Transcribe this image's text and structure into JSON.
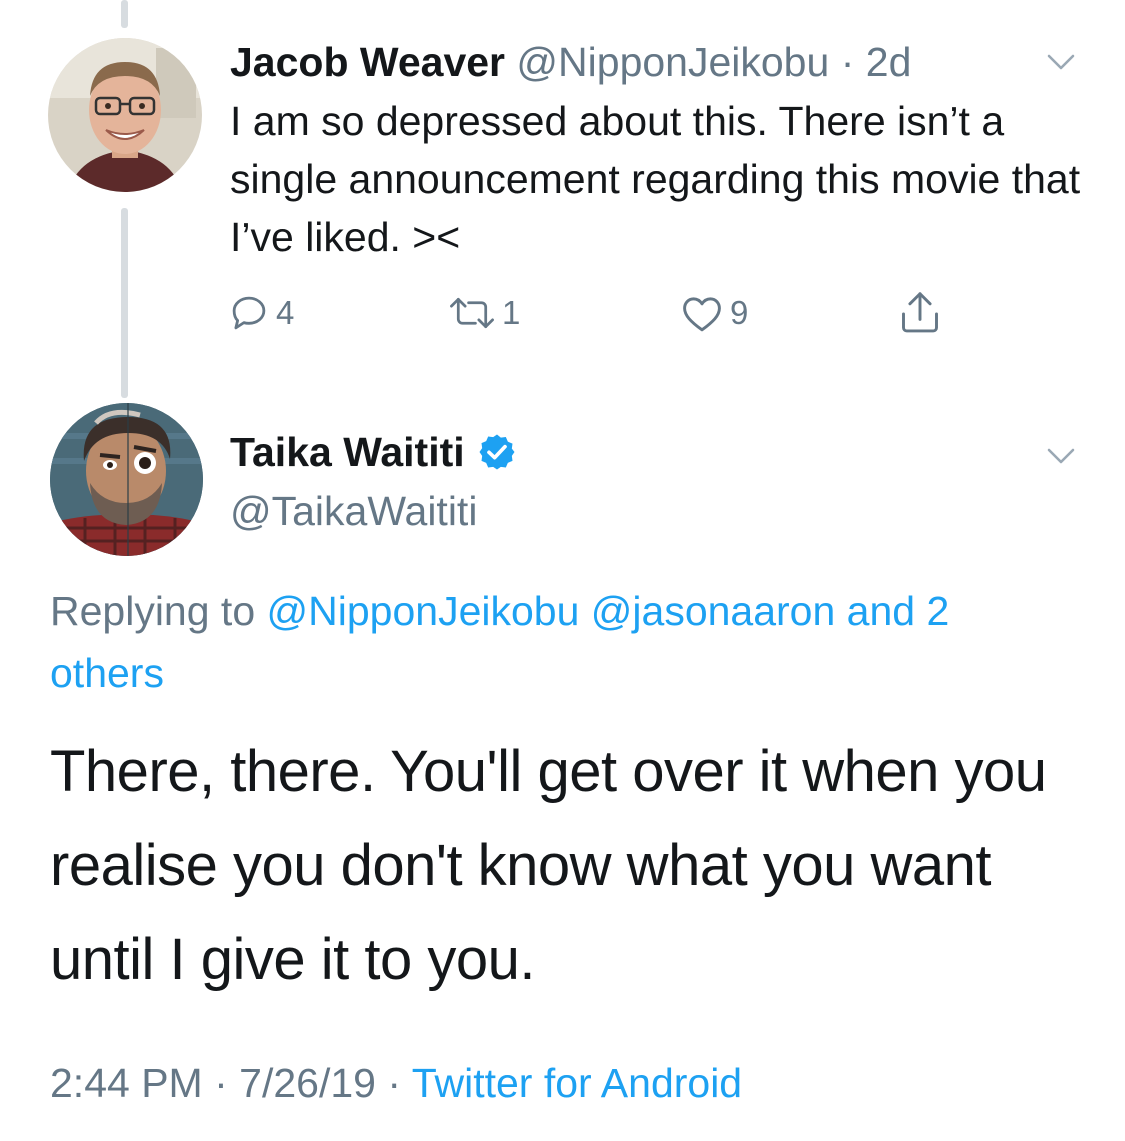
{
  "parent_tweet": {
    "author_name": "Jacob Weaver",
    "handle": "@NipponJeikobu",
    "separator": "·",
    "time_ago": "2d",
    "text": "I am so depressed about this. There isn’t a single announcement regarding this movie that I’ve liked. ><",
    "actions": {
      "reply_count": "4",
      "retweet_count": "1",
      "like_count": "9"
    }
  },
  "main_tweet": {
    "author_name": "Taika Waititi",
    "handle": "@TaikaWaititi",
    "replying_prefix": "Replying to",
    "replying_to": "@NipponJeikobu @jasonaaron and 2 others",
    "text": "There, there. You'll get over it when you realise you don't know what you want until I give it to you.",
    "time": "2:44 PM",
    "separator_1": "·",
    "date": "7/26/19",
    "separator_2": "·",
    "source": "Twitter for Android"
  },
  "icons": {
    "caret": "chevron-down-icon",
    "reply": "comment-icon",
    "retweet": "retweet-icon",
    "like": "heart-icon",
    "share": "share-icon",
    "verified": "verified-badge-icon"
  },
  "colors": {
    "text_primary": "#14171a",
    "text_secondary": "#657786",
    "link": "#1da1f2",
    "verified": "#1da1f2",
    "thread_line": "#d7dce0"
  }
}
